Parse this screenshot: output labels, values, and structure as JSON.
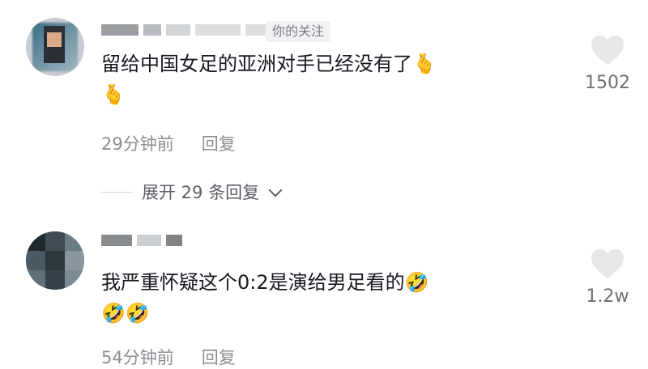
{
  "comments": [
    {
      "follow_tag": "你的关注",
      "text_line1": "留给中国女足的亚洲对手已经没有了",
      "emoji_line1": "🫰",
      "emoji_line2": "🫰",
      "time": "29分钟前",
      "reply": "回复",
      "expand_label": "展开 29 条回复",
      "likes": "1502"
    },
    {
      "text_line1": "我严重怀疑这个0:2是演给男足看的",
      "emoji_line1": "🤣",
      "emoji_line2": "🤣🤣",
      "time": "54分钟前",
      "reply": "回复",
      "likes": "1.2w"
    }
  ],
  "colors": {
    "text": "#161823",
    "meta": "#8a8d93",
    "heart": "#e8e9eb",
    "follow_bg": "#f1f2f4"
  }
}
